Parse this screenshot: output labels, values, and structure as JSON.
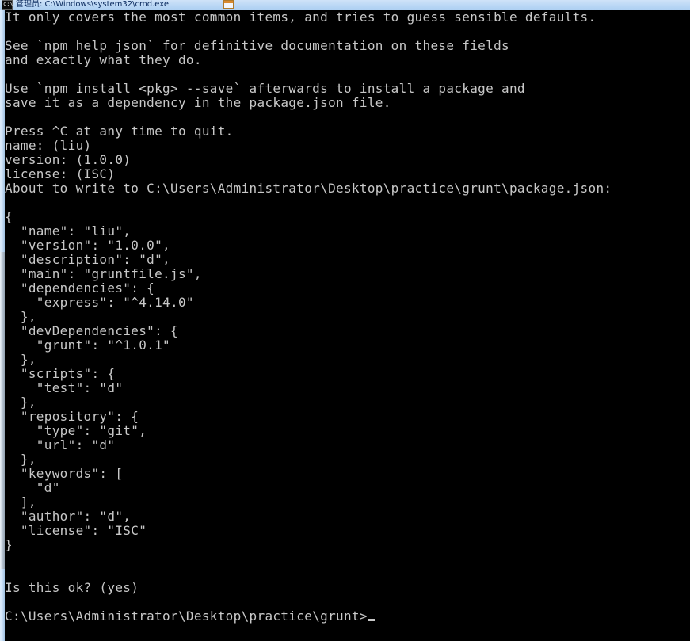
{
  "window": {
    "titlebar": {
      "title": "管理员: C:\\Windows\\system32\\cmd.exe",
      "icon": "cmd-console-icon"
    },
    "background_color": "#000000",
    "text_color": "#c8c8c8",
    "titlebar_color": "#bcd8f5"
  },
  "console": {
    "prompt": "C:\\Users\\Administrator\\Desktop\\practice\\grunt>",
    "cursor": "block-cursor",
    "lines": [
      "It only covers the most common items, and tries to guess sensible defaults.",
      "",
      "See `npm help json` for definitive documentation on these fields",
      "and exactly what they do.",
      "",
      "Use `npm install <pkg> --save` afterwards to install a package and",
      "save it as a dependency in the package.json file.",
      "",
      "Press ^C at any time to quit.",
      "name: (liu)",
      "version: (1.0.0)",
      "license: (ISC)",
      "About to write to C:\\Users\\Administrator\\Desktop\\practice\\grunt\\package.json:",
      "",
      "{",
      "  \"name\": \"liu\",",
      "  \"version\": \"1.0.0\",",
      "  \"description\": \"d\",",
      "  \"main\": \"gruntfile.js\",",
      "  \"dependencies\": {",
      "    \"express\": \"^4.14.0\"",
      "  },",
      "  \"devDependencies\": {",
      "    \"grunt\": \"^1.0.1\"",
      "  },",
      "  \"scripts\": {",
      "    \"test\": \"d\"",
      "  },",
      "  \"repository\": {",
      "    \"type\": \"git\",",
      "    \"url\": \"d\"",
      "  },",
      "  \"keywords\": [",
      "    \"d\"",
      "  ],",
      "  \"author\": \"d\",",
      "  \"license\": \"ISC\"",
      "}",
      "",
      "",
      "Is this ok? (yes)",
      ""
    ]
  }
}
